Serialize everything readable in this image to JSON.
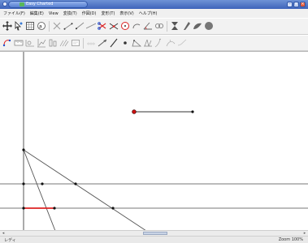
{
  "window": {
    "title": "Easy Charted",
    "minimize_glyph": "–",
    "maximize_glyph": "□",
    "close_glyph": "×"
  },
  "menu": [
    "ファイル(F)",
    "編集(E)",
    "View",
    "変換(T)",
    "作図(D)",
    "変形(T)",
    "表示(V)",
    "ヘルプ(H)"
  ],
  "toolbar1": [
    "move-icon",
    "select-icon",
    "grid-icon",
    "text-icon",
    "line-x-icon",
    "segment-icon",
    "ray-icon",
    "line-icon",
    "scissors-icon",
    "intersection-icon",
    "circle-icon",
    "arc-icon",
    "angle-icon",
    "link-icon",
    "transform-icon",
    "fill-icon",
    "paint-icon",
    "color-icon"
  ],
  "toolbar2": [
    "point-tool-icon",
    "ruler-icon",
    "measure-icon",
    "coord-icon",
    "area-icon",
    "locus-icon",
    "macro-icon",
    "arrow-icon",
    "draw-line-icon",
    "dot-icon",
    "triangle-icon",
    "split-icon",
    "label-icon",
    "curve-icon",
    "bezier-icon"
  ],
  "statusbar": {
    "left": "レディ",
    "right": "Zoom 100%"
  },
  "colors": {
    "red_point": "#cc1111",
    "red_segment": "#dd2222"
  }
}
